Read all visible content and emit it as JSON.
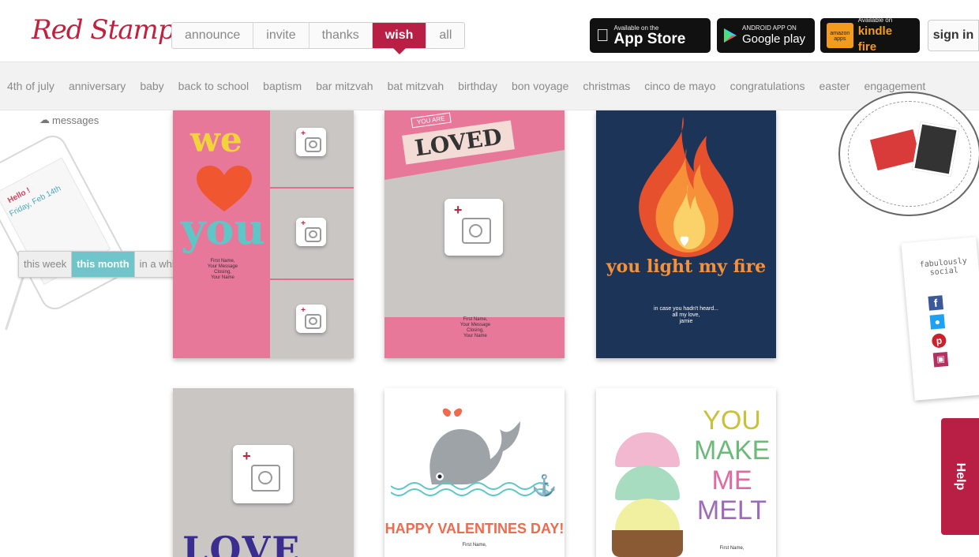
{
  "brand": {
    "logo": "Red Stamp"
  },
  "category_tabs": [
    "announce",
    "invite",
    "thanks",
    "wish",
    "all"
  ],
  "active_category": "wish",
  "app_badges": {
    "appstore": {
      "small": "Available on the",
      "big": "App Store"
    },
    "google": {
      "small": "ANDROID APP ON",
      "big": "Google play"
    },
    "kindle": {
      "small": "Available on",
      "big": "kindle fire",
      "tag": "amazon apps"
    }
  },
  "signin_label": "sign in",
  "occasions": [
    "4th of july",
    "anniversary",
    "baby",
    "back to school",
    "baptism",
    "bar mitzvah",
    "bat mitzvah",
    "birthday",
    "bon voyage",
    "christmas",
    "cinco de mayo",
    "congratulations",
    "easter",
    "engagement"
  ],
  "messages_label": "messages",
  "phone": {
    "greeting": "Hello !",
    "date": "Friday, Feb 14th"
  },
  "time_filter": [
    "this week",
    "this month",
    "in a while"
  ],
  "active_time": "this month",
  "cards": {
    "c1": {
      "line1": "we",
      "line2": "you",
      "signoff": "First Name,\nYour Message\nClosing,\nYour Name"
    },
    "c2": {
      "banner": "YOU ARE",
      "title": "LOVED",
      "signoff": "First Name,\nYour Message\nClosing,\nYour Name"
    },
    "c3": {
      "title": "you light my fire",
      "message": "in case you hadn't heard...\nall my love,\njamie"
    },
    "c4": {
      "title": "LOVE"
    },
    "c5": {
      "title": "HAPPY VALENTINES DAY!",
      "signoff": "First Name,"
    },
    "c6": {
      "lines": [
        "YOU",
        "MAKE",
        "ME",
        "MELT"
      ],
      "signoff": "First Name,"
    }
  },
  "social": {
    "title": "fabulously social"
  },
  "help_label": "Help",
  "colors": {
    "brand": "#b91f45",
    "teal": "#6fc5c9"
  }
}
